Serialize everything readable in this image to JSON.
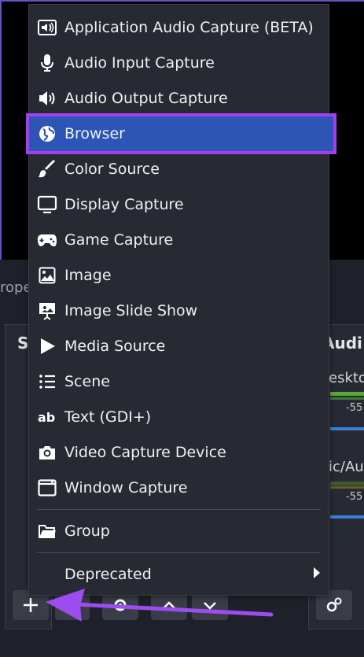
{
  "menu": {
    "items": [
      {
        "label": "Application Audio Capture (BETA)",
        "icon": "speaker-box-icon"
      },
      {
        "label": "Audio Input Capture",
        "icon": "microphone-icon"
      },
      {
        "label": "Audio Output Capture",
        "icon": "speaker-icon"
      },
      {
        "label": "Browser",
        "icon": "globe-icon"
      },
      {
        "label": "Color Source",
        "icon": "paint-brush-icon"
      },
      {
        "label": "Display Capture",
        "icon": "monitor-icon"
      },
      {
        "label": "Game Capture",
        "icon": "gamepad-icon"
      },
      {
        "label": "Image",
        "icon": "image-icon"
      },
      {
        "label": "Image Slide Show",
        "icon": "slideshow-icon"
      },
      {
        "label": "Media Source",
        "icon": "play-icon"
      },
      {
        "label": "Scene",
        "icon": "list-icon"
      },
      {
        "label": "Text (GDI+)",
        "icon": "text-icon"
      },
      {
        "label": "Video Capture Device",
        "icon": "camera-icon"
      },
      {
        "label": "Window Capture",
        "icon": "window-icon"
      }
    ],
    "group_label": "Group",
    "deprecated_label": "Deprecated",
    "highlighted": "Browser"
  },
  "background": {
    "properties_tab_fragment": "rope",
    "sources_title_fragment": "S",
    "audio_title_fragment": "Audi",
    "audio_channel_1": "eskto",
    "audio_channel_2": "ic/Au",
    "db_1": "-55",
    "db_2": "-55"
  },
  "colors": {
    "highlight_bg": "#2c55b5",
    "highlight_outline": "#a63ef0",
    "arrow": "#9b4df0"
  }
}
